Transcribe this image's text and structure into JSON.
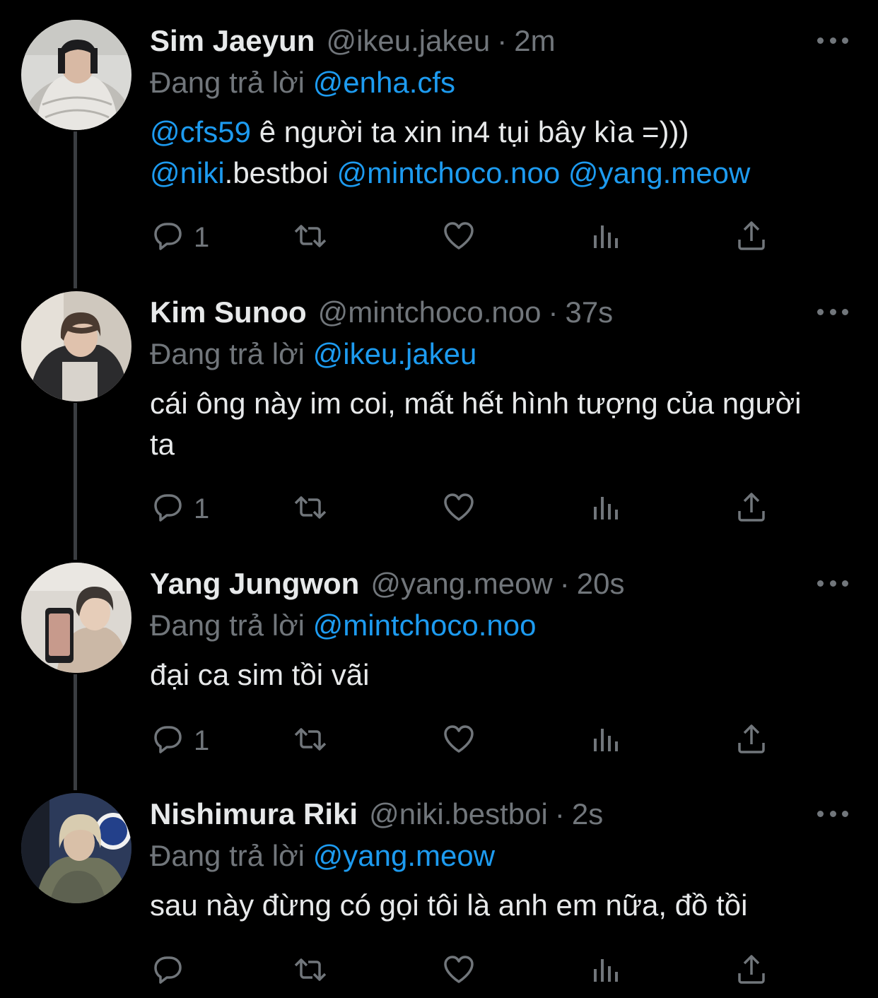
{
  "colors": {
    "background": "#000000",
    "text": "#e7e9ea",
    "muted": "#71767b",
    "link": "#1d9bf0"
  },
  "reply_label": "Đang trả lời",
  "tweets": [
    {
      "display_name": "Sim Jaeyun",
      "handle": "@ikeu.jakeu",
      "time": "2m",
      "reply_to": "@enha.cfs",
      "body": {
        "mention_1": "@cfs59",
        "text_1": " ê người ta xin in4 tụi bây kìa =)))",
        "mention_2": "@niki",
        "text_2": ".bestboi ",
        "mention_3": "@mintchoco.noo",
        "text_3": " ",
        "mention_4": "@yang.meow"
      },
      "reply_count": "1",
      "avatar_icon": "avatar-photo"
    },
    {
      "display_name": "Kim Sunoo",
      "handle": "@mintchoco.noo",
      "time": "37s",
      "reply_to": "@ikeu.jakeu",
      "body_text": "cái ông này im coi, mất hết hình tượng của người ta",
      "reply_count": "1",
      "avatar_icon": "avatar-photo"
    },
    {
      "display_name": "Yang Jungwon",
      "handle": "@yang.meow",
      "time": "20s",
      "reply_to": "@mintchoco.noo",
      "body_text": "đại ca sim tồi vãi",
      "reply_count": "1",
      "avatar_icon": "avatar-photo"
    },
    {
      "display_name": "Nishimura Riki",
      "handle": "@niki.bestboi",
      "time": "2s",
      "reply_to": "@yang.meow",
      "body_text": "sau này đừng có gọi tôi là anh em nữa, đồ tồi",
      "reply_count": "",
      "avatar_icon": "avatar-photo"
    }
  ],
  "action_icons": [
    "reply-icon",
    "retweet-icon",
    "like-icon",
    "views-icon",
    "share-icon"
  ],
  "separator": "·"
}
